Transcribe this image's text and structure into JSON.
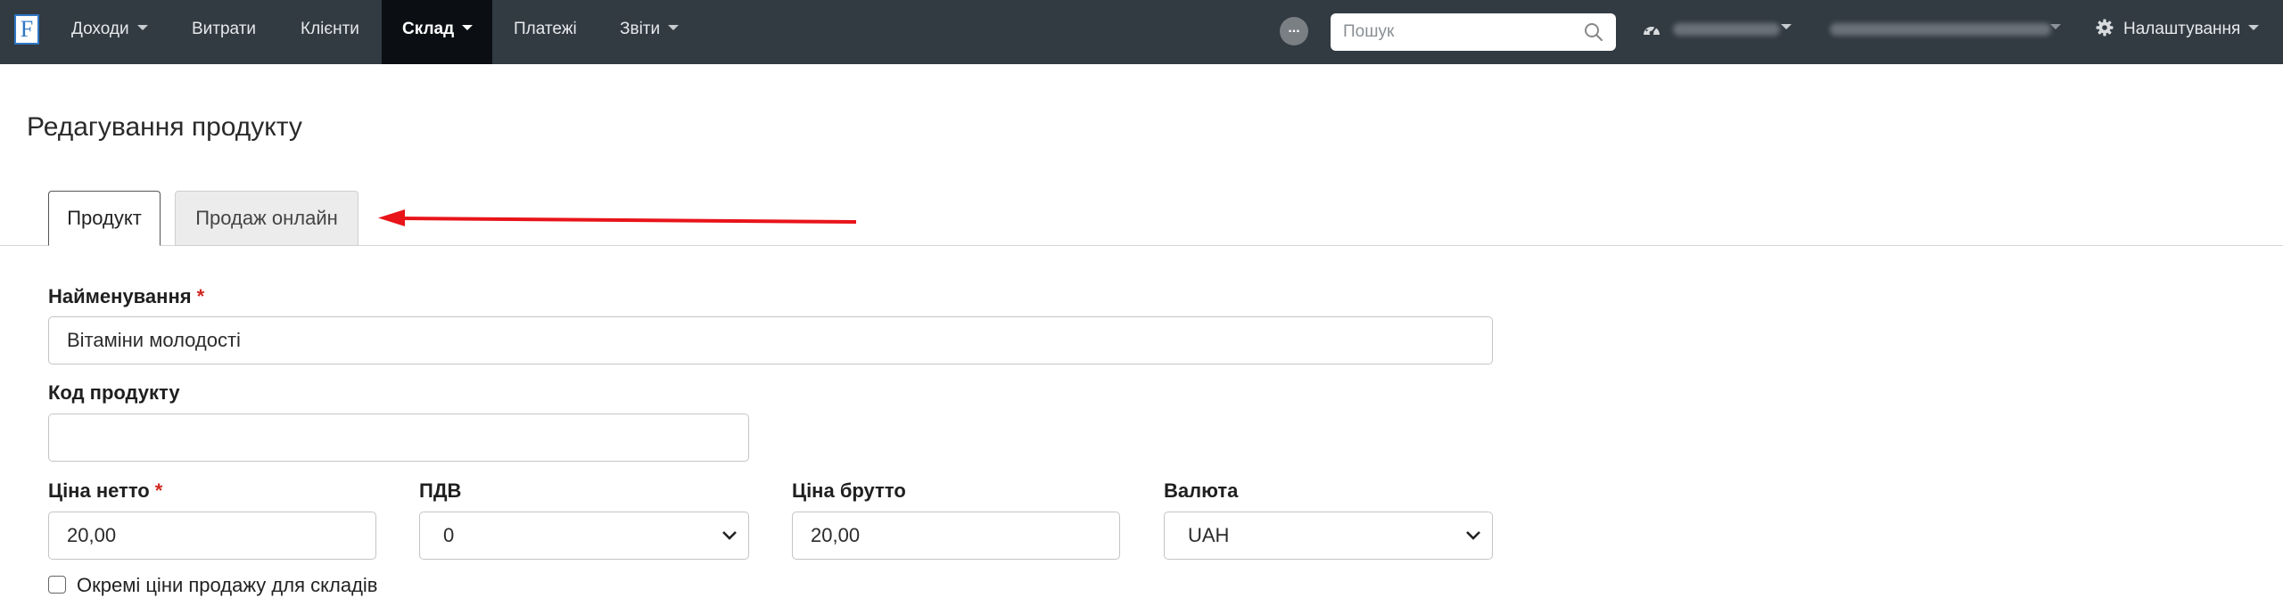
{
  "navbar": {
    "logo_letter": "F",
    "items": [
      {
        "label": "Доходи",
        "has_caret": true
      },
      {
        "label": "Витрати",
        "has_caret": false
      },
      {
        "label": "Клієнти",
        "has_caret": false
      },
      {
        "label": "Склад",
        "has_caret": true,
        "active": true
      },
      {
        "label": "Платежі",
        "has_caret": false
      },
      {
        "label": "Звіти",
        "has_caret": true
      }
    ],
    "notifications_badge": "...",
    "search": {
      "placeholder": "Пошук",
      "value": ""
    },
    "settings_label": "Налаштування",
    "icons": {
      "dashboard": "dashboard-icon",
      "search": "search-icon",
      "settings": "gear-icon"
    }
  },
  "page": {
    "title": "Редагування продукту",
    "tabs": [
      {
        "label": "Продукт",
        "active": true
      },
      {
        "label": "Продаж онлайн",
        "active": false
      }
    ]
  },
  "form": {
    "name": {
      "label": "Найменування",
      "required_mark": "*",
      "value": "Вітаміни молодості"
    },
    "code": {
      "label": "Код продукту",
      "value": ""
    },
    "net_price": {
      "label": "Ціна нетто",
      "required_mark": "*",
      "value": "20,00"
    },
    "vat": {
      "label": "ПДВ",
      "selected": "0"
    },
    "gross_price": {
      "label": "Ціна брутто",
      "value": "20,00"
    },
    "currency": {
      "label": "Валюта",
      "selected": "UAH"
    },
    "separate_prices": {
      "label": "Окремі ціни продажу для складів",
      "checked": false
    }
  },
  "colors": {
    "navbar_bg": "#323a42",
    "navbar_active_bg": "#0b0f13",
    "required": "#d0281f",
    "annotation_arrow": "#e8141a"
  }
}
